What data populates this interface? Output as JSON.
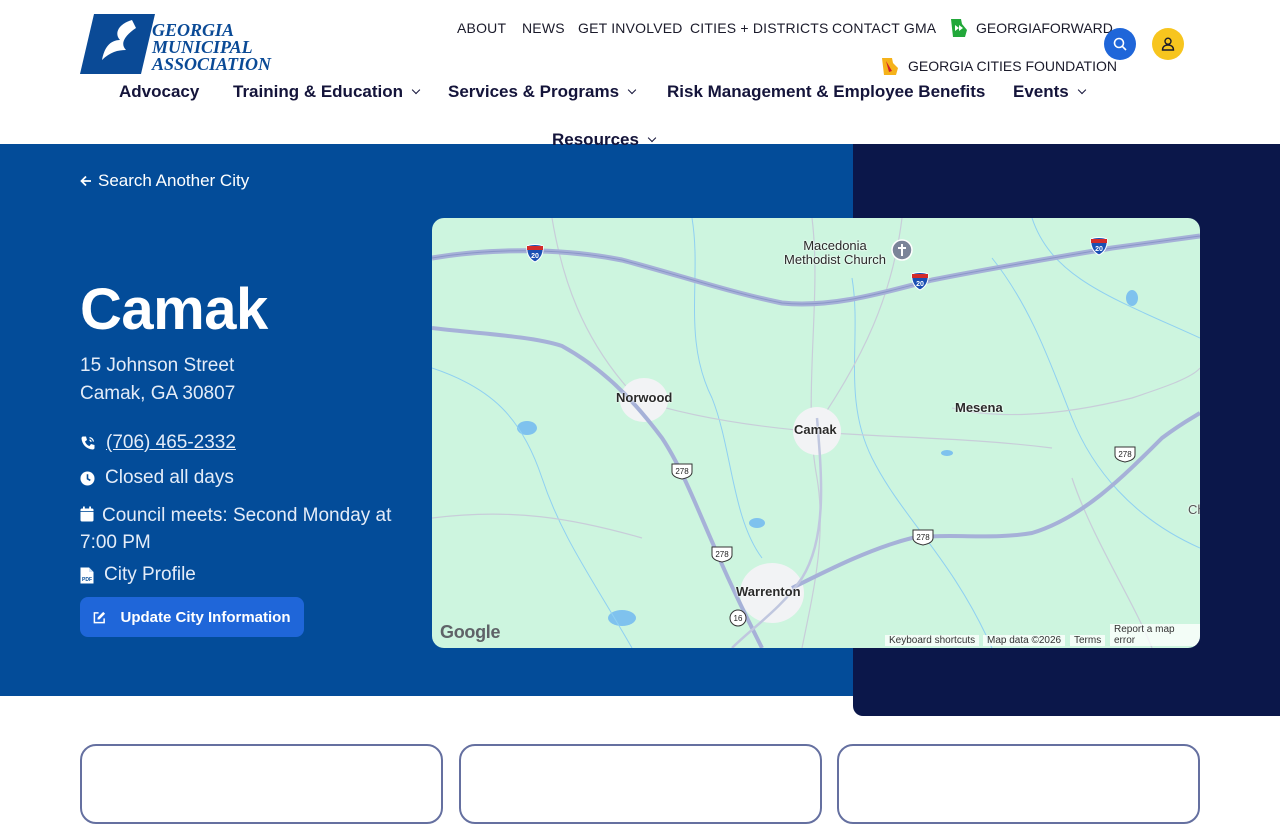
{
  "logo": {
    "line1": "GEORGIA",
    "line2": "MUNICIPAL",
    "line3": "ASSOCIATION"
  },
  "top_nav": {
    "about": "ABOUT",
    "news": "NEWS",
    "get_involved": "GET INVOLVED",
    "cities_districts": "CITIES + DISTRICTS",
    "contact": "CONTACT GMA",
    "georgia_forward": "GEORGIAFORWARD",
    "cities_foundation": "GEORGIA CITIES FOUNDATION"
  },
  "main_nav": {
    "advocacy": "Advocacy",
    "training": "Training & Education",
    "services": "Services & Programs",
    "risk": "Risk Management & Employee Benefits",
    "events": "Events",
    "resources": "Resources"
  },
  "hero": {
    "back_link": "Search Another City",
    "city_name": "Camak",
    "address_line1": "15 Johnson Street",
    "address_line2": "Camak, GA 30807",
    "phone": "(706) 465-2332",
    "hours": "Closed all days",
    "council": "Council meets: Second Monday at 7:00 PM",
    "profile": "City Profile",
    "update_button": "Update City Information"
  },
  "map": {
    "places": {
      "macedonia": "Macedonia Methodist Church",
      "norwood": "Norwood",
      "camak": "Camak",
      "mesena": "Mesena",
      "warrenton": "Warrenton",
      "partial": "Ch"
    },
    "shields": {
      "i20": "20",
      "us278": "278",
      "ga16": "16"
    },
    "google": "Google",
    "keyboard": "Keyboard shortcuts",
    "map_data": "Map data ©2026",
    "terms": "Terms",
    "report": "Report a map error"
  },
  "colors": {
    "brand_blue": "#034c99",
    "navy": "#0b174a",
    "button_blue": "#1f66d9",
    "account_yellow": "#f7c51e",
    "map_green": "#cdf5df"
  }
}
